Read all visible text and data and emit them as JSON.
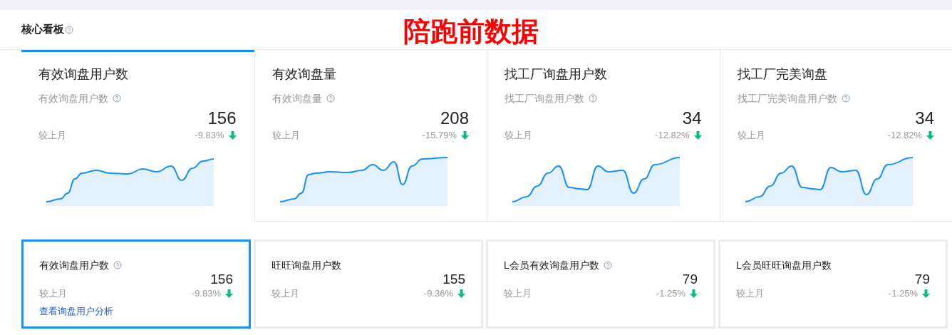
{
  "header": {
    "title": "核心看板",
    "help": true
  },
  "overlay_caption": "陪跑前数据",
  "top_cards": [
    {
      "title": "有效询盘用户数",
      "subtitle": "有效询盘用户数",
      "help": true,
      "value": "156",
      "compare_label": "较上月",
      "change": "-9.83%",
      "decreasing": true,
      "selected": true
    },
    {
      "title": "有效询盘量",
      "subtitle": "有效询盘量",
      "help": true,
      "value": "208",
      "compare_label": "较上月",
      "change": "-15.79%",
      "decreasing": true,
      "selected": false
    },
    {
      "title": "找工厂询盘用户数",
      "subtitle": "找工厂询盘用户数",
      "help": true,
      "value": "34",
      "compare_label": "较上月",
      "change": "-12.82%",
      "decreasing": true,
      "selected": false
    },
    {
      "title": "找工厂完美询盘",
      "subtitle": "找工厂完美询盘用户数",
      "help": true,
      "value": "34",
      "compare_label": "较上月",
      "change": "-12.82%",
      "decreasing": true,
      "selected": false
    }
  ],
  "bottom_cards": [
    {
      "title": "有效询盘用户数",
      "help": true,
      "value": "156",
      "compare_label": "较上月",
      "change": "-9.83%",
      "decreasing": true,
      "selected": true,
      "link": "查看询盘用户分析"
    },
    {
      "title": "旺旺询盘用户数",
      "help": false,
      "value": "155",
      "compare_label": "较上月",
      "change": "-9.36%",
      "decreasing": true,
      "selected": false
    },
    {
      "title": "L会员有效询盘用户数",
      "help": true,
      "value": "79",
      "compare_label": "较上月",
      "change": "-1.25%",
      "decreasing": true,
      "selected": false
    },
    {
      "title": "L会员旺旺询盘用户数",
      "help": false,
      "value": "79",
      "compare_label": "较上月",
      "change": "-1.25%",
      "decreasing": true,
      "selected": false
    }
  ]
}
